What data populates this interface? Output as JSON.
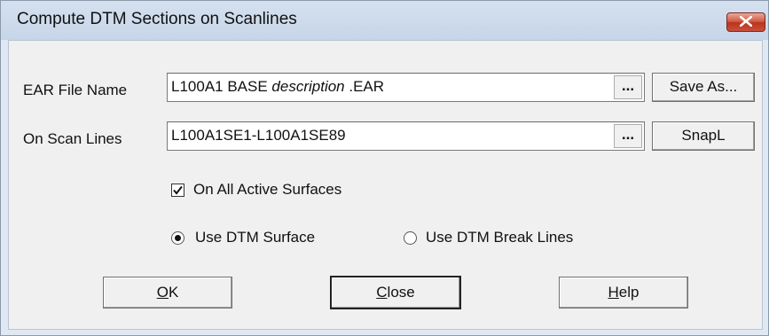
{
  "window": {
    "title": "Compute DTM Sections on Scanlines",
    "close_icon": "close-x-icon",
    "close_color": "#c9503a"
  },
  "ear_file": {
    "label": "EAR File Name",
    "value_prefix": "L100A1 BASE ",
    "value_italic": "description",
    "value_suffix": " .EAR",
    "browse_label": "...",
    "save_as_label": "Save As..."
  },
  "scan_lines": {
    "label": "On Scan Lines",
    "value": "L100A1SE1-L100A1SE89",
    "browse_label": "...",
    "snap_label": "SnapL"
  },
  "options": {
    "all_surfaces_label": "On All Active Surfaces",
    "all_surfaces_checked": true,
    "use_surface_label": "Use DTM Surface",
    "use_break_lines_label": "Use DTM Break Lines",
    "selected_mode": "Use DTM Surface"
  },
  "buttons": {
    "ok_underline": "O",
    "ok_rest": "K",
    "close_underline": "C",
    "close_rest": "lose",
    "help_underline": "H",
    "help_rest": "elp"
  }
}
